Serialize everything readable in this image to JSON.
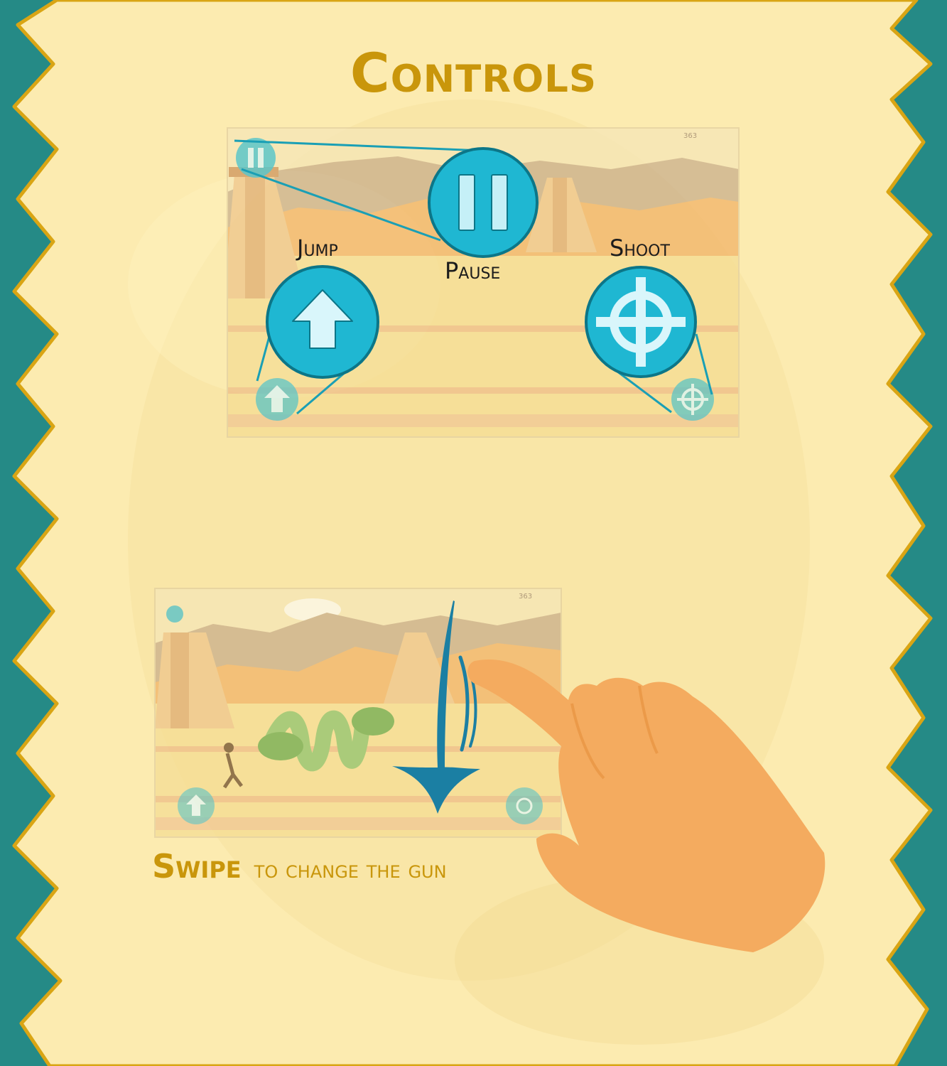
{
  "screen": {
    "title": "Controls",
    "bg_teal": "#258a86",
    "parchment": "#fcebb0",
    "accent_gold": "#c9960b",
    "button_blue": "#1fb7d2"
  },
  "panel1": {
    "score": "363",
    "jump_label": "Jump",
    "pause_label": "Pause",
    "shoot_label": "Shoot",
    "icons": [
      "pause-icon",
      "up-arrow-icon",
      "crosshair-icon"
    ]
  },
  "panel2": {
    "score": "363",
    "instruction_strong": "Swipe",
    "instruction_rest": "to change the gun",
    "icons": [
      "swipe-down-arrow-icon",
      "hand-pointer-icon"
    ]
  }
}
